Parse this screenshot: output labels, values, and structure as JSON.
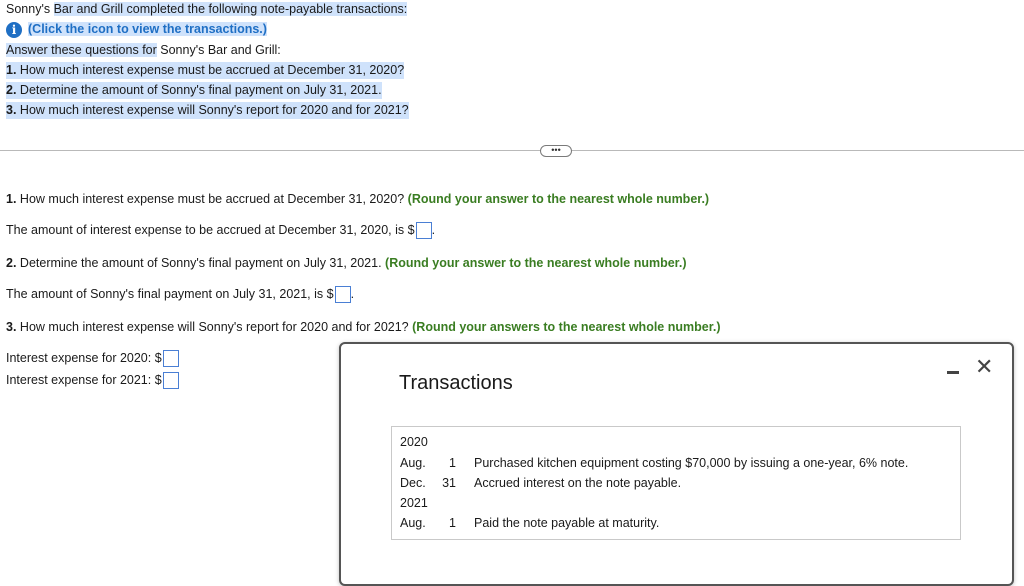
{
  "header": {
    "intro_name": "Sonny's",
    "intro_rest": "Bar and Grill completed the following note-payable transactions:",
    "click_link": "(Click the icon to view the transactions.)",
    "answer_prefix": "Answer these questions for",
    "answer_name": "Sonny's Bar and Grill:",
    "questions": [
      {
        "num": "1.",
        "text": "How much interest expense must be accrued at December 31, 2020?"
      },
      {
        "num": "2.",
        "text": "Determine the amount of Sonny's final payment on July 31, 2021."
      },
      {
        "num": "3.",
        "text": "How much interest expense will Sonny's report for 2020 and for 2021?"
      }
    ]
  },
  "expand_label": "•••",
  "main": {
    "q1_num": "1.",
    "q1_text": "How much interest expense must be accrued at December 31, 2020?",
    "q1_hint": "(Round your answer to the nearest whole number.)",
    "q1_answer_prefix": "The amount of interest expense to be accrued at December 31, 2020, is $",
    "q2_num": "2.",
    "q2_text": "Determine the amount of Sonny's final payment on July 31, 2021.",
    "q2_hint": "(Round your answer to the nearest whole number.)",
    "q2_answer_prefix": "The amount of Sonny's final payment on July 31, 2021, is $",
    "q3_num": "3.",
    "q3_text": "How much interest expense will Sonny's report for 2020 and for 2021?",
    "q3_hint": "(Round your answers to the nearest whole number.)",
    "q3_label_2020": "Interest expense for 2020: $",
    "q3_label_2021": "Interest expense for 2021: $",
    "period": "."
  },
  "modal": {
    "title": "Transactions",
    "year1": "2020",
    "rows1": [
      {
        "month": "Aug.",
        "day": "1",
        "desc": "Purchased kitchen equipment costing $70,000 by issuing a one-year, 6% note."
      },
      {
        "month": "Dec.",
        "day": "31",
        "desc": "Accrued interest on the note payable."
      }
    ],
    "year2": "2021",
    "rows2": [
      {
        "month": "Aug.",
        "day": "1",
        "desc": "Paid the note payable at maturity."
      }
    ]
  },
  "colors": {
    "highlight": "#cfe2fb",
    "hint_green": "#3a7d22",
    "link_blue": "#1f6fc4"
  }
}
